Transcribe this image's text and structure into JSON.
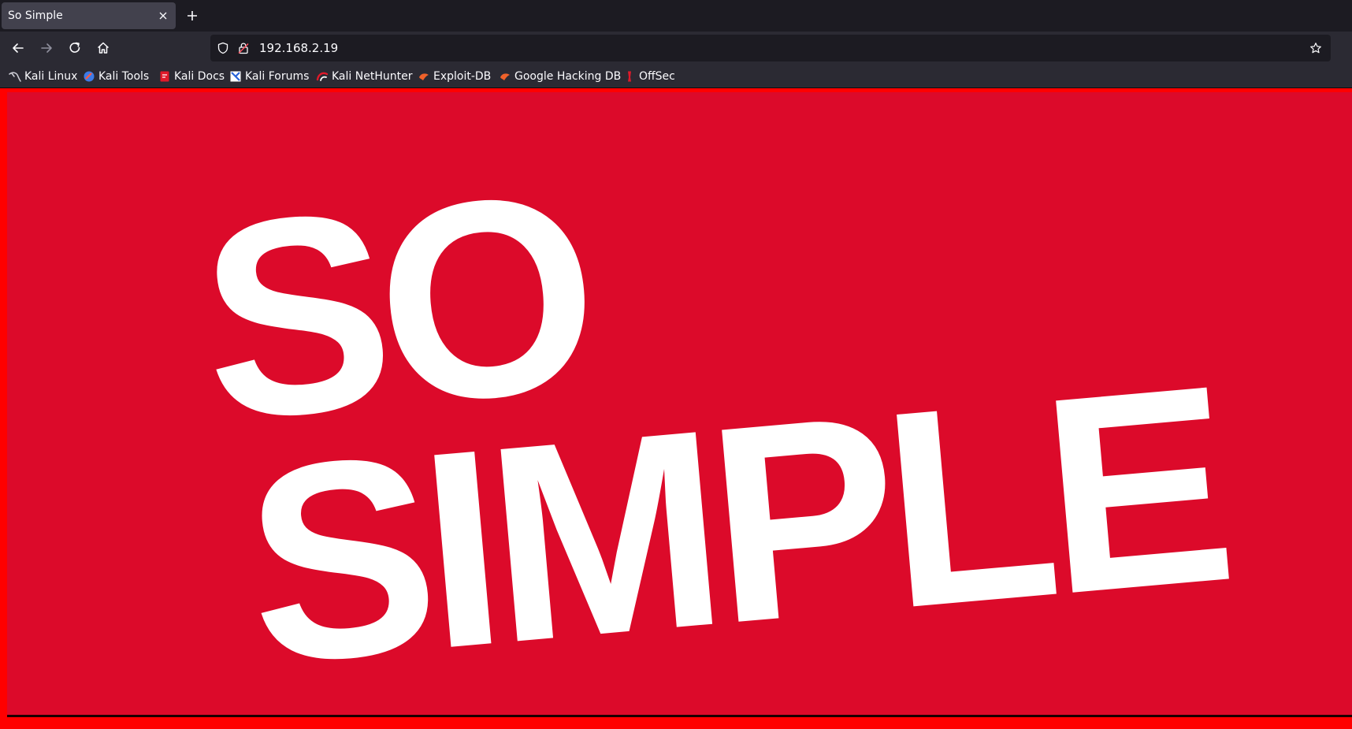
{
  "browser": {
    "tab": {
      "title": "So Simple"
    },
    "url": "192.168.2.19",
    "bookmarks": [
      {
        "label": "Kali Linux",
        "icon": "kali-dragon-icon"
      },
      {
        "label": "Kali Tools",
        "icon": "kali-tools-icon"
      },
      {
        "label": "Kali Docs",
        "icon": "kali-docs-icon"
      },
      {
        "label": "Kali Forums",
        "icon": "kali-forums-icon"
      },
      {
        "label": "Kali NetHunter",
        "icon": "kali-nethunter-icon"
      },
      {
        "label": "Exploit-DB",
        "icon": "exploit-db-icon"
      },
      {
        "label": "Google Hacking DB",
        "icon": "ghdb-icon"
      },
      {
        "label": "OffSec",
        "icon": "offsec-icon"
      }
    ]
  },
  "page": {
    "banner": {
      "line1": "SO",
      "line2": "SIMPLE",
      "background_color": "#dc0a2a",
      "text_color": "#ffffff"
    },
    "page_background_color": "#ff0000"
  }
}
